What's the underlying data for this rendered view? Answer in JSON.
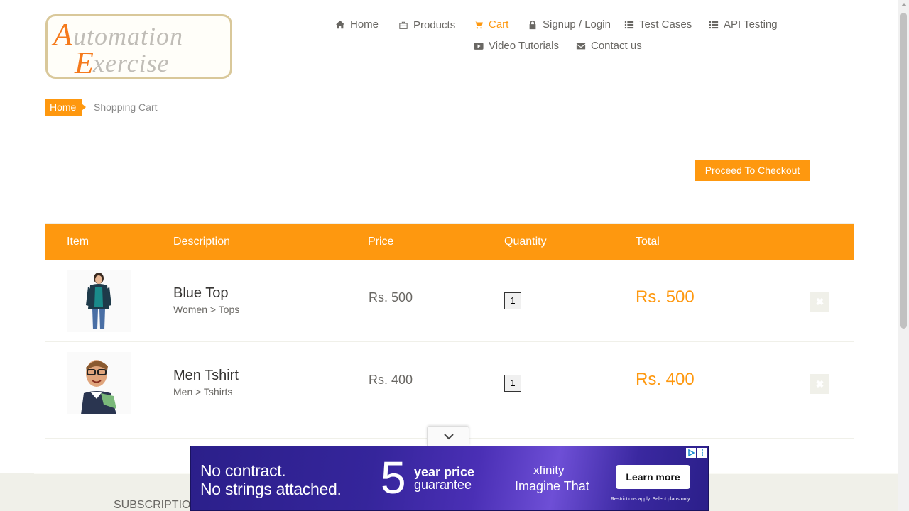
{
  "logo": {
    "line1": "Automation",
    "line2": "Exercise"
  },
  "nav": [
    {
      "label": "Home",
      "icon": "home-icon",
      "active": false
    },
    {
      "label": "Products",
      "icon": "briefcase-icon",
      "active": false
    },
    {
      "label": "Cart",
      "icon": "cart-icon",
      "active": true
    },
    {
      "label": "Signup / Login",
      "icon": "lock-icon",
      "active": false
    },
    {
      "label": "Test Cases",
      "icon": "list-icon",
      "active": false
    },
    {
      "label": "API Testing",
      "icon": "list-icon",
      "active": false
    },
    {
      "label": "Video Tutorials",
      "icon": "youtube-icon",
      "active": false
    },
    {
      "label": "Contact us",
      "icon": "envelope-icon",
      "active": false
    }
  ],
  "breadcrumb": {
    "home": "Home",
    "current": "Shopping Cart"
  },
  "checkout_button": "Proceed To Checkout",
  "table": {
    "headers": {
      "item": "Item",
      "description": "Description",
      "price": "Price",
      "quantity": "Quantity",
      "total": "Total"
    },
    "rows": [
      {
        "name": "Blue Top",
        "category": "Women > Tops",
        "price": "Rs. 500",
        "quantity": "1",
        "total": "Rs. 500",
        "delete": "✖"
      },
      {
        "name": "Men Tshirt",
        "category": "Men > Tshirts",
        "price": "Rs. 400",
        "quantity": "1",
        "total": "Rs. 400",
        "delete": "✖"
      }
    ]
  },
  "footer": {
    "subscription": "SUBSCRIPTION"
  },
  "ad": {
    "line1": "No contract.",
    "line2": "No strings attached.",
    "big_number": "5",
    "year_price": "year price",
    "guarantee": "guarantee",
    "brand": "xfinity",
    "tagline": "Imagine That",
    "cta": "Learn more",
    "fine_print": "Restrictions apply. Select plans only.",
    "menu": "⋮"
  },
  "colors": {
    "accent": "#FE980F",
    "text": "#696763",
    "ad_bg": "#35259b"
  }
}
